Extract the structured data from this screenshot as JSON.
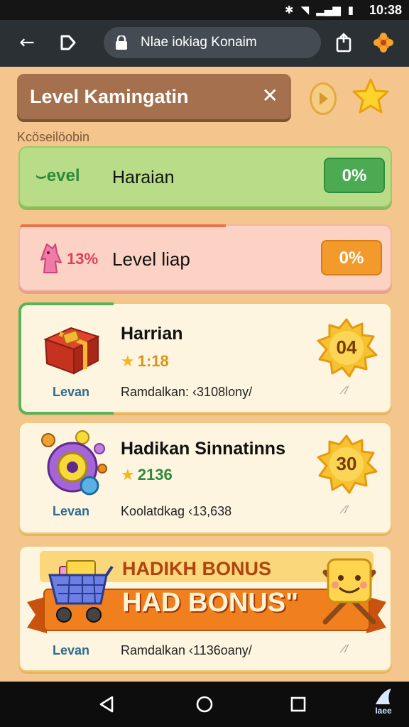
{
  "status_bar": {
    "time": "10:38",
    "icons": [
      "bluetooth-icon",
      "wifi-icon",
      "signal-icon",
      "battery-icon"
    ]
  },
  "browser": {
    "url": "Nlae iokiag Konaim"
  },
  "header": {
    "title": "Level Kamingatin"
  },
  "section_label": "Kcöseilöobin",
  "green_card": {
    "lead": "evel",
    "title": "Haraian",
    "percent": "0%"
  },
  "pink_card": {
    "percent_left": "13%",
    "title": "Level liap",
    "percent": "0%"
  },
  "item1": {
    "title": "Harrian",
    "score": "1:18",
    "level": "Levan",
    "meta": "Ramdalkan: ‹3108lony/",
    "end": "⁄/",
    "badge": "04"
  },
  "item2": {
    "title": "Hadikan Sinnatinns",
    "score": "2136",
    "level": "Levan",
    "meta": "Koolatdkag ‹13,638",
    "end": "⁄/",
    "badge": "30"
  },
  "item3": {
    "bonus_top": "HADIKH BONUS",
    "bonus_main": "HAD BONUS\"",
    "level": "Levan",
    "meta": "Ramdalkan ‹1136oany/",
    "end": "⁄/"
  },
  "navbar": {
    "corner_label": "Iaee"
  },
  "colors": {
    "accent_green": "#4caa52",
    "accent_orange": "#f29a2c",
    "title_brown": "#a4704d",
    "background": "#f4c58d"
  }
}
